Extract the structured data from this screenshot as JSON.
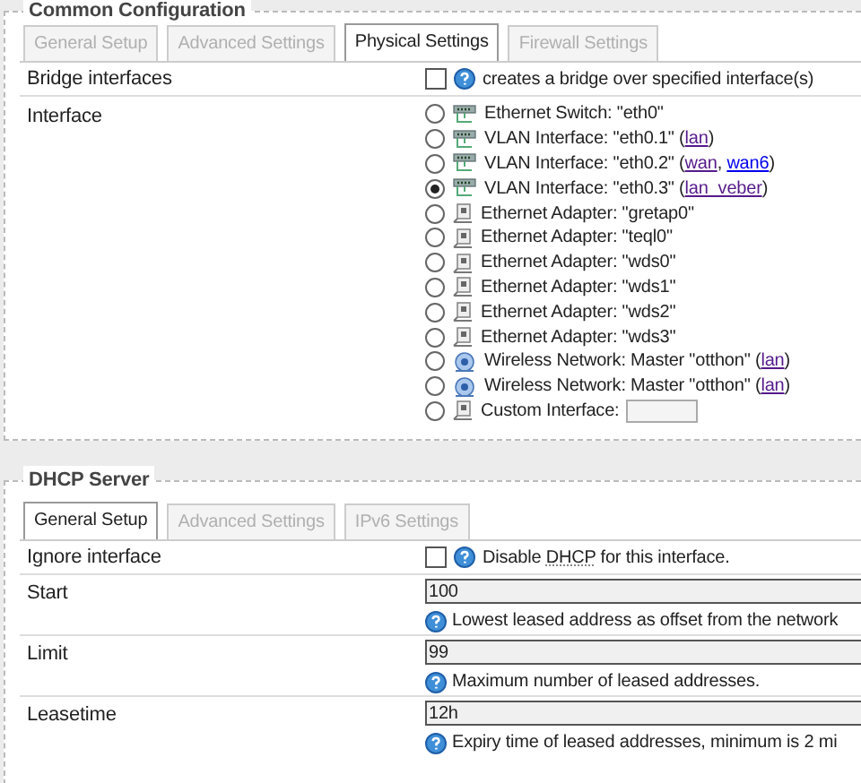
{
  "common": {
    "legend": "Common Configuration",
    "tabs": [
      {
        "label": "General Setup",
        "selected": false
      },
      {
        "label": "Advanced Settings",
        "selected": false
      },
      {
        "label": "Physical Settings",
        "selected": true
      },
      {
        "label": "Firewall Settings",
        "selected": false
      }
    ],
    "bridge": {
      "label": "Bridge interfaces",
      "checked": false,
      "help": "creates a bridge over specified interface(s)"
    },
    "interface": {
      "label": "Interface",
      "options": [
        {
          "kind": "switch",
          "selected": false,
          "parts": [
            {
              "kind": "text",
              "text": "Ethernet Switch: \"eth0\""
            }
          ]
        },
        {
          "kind": "switch",
          "selected": false,
          "parts": [
            {
              "kind": "text",
              "text": "VLAN Interface: \"eth0.1\" ("
            },
            {
              "kind": "link",
              "text": "lan",
              "visited": true
            },
            {
              "kind": "text",
              "text": ")"
            }
          ]
        },
        {
          "kind": "switch",
          "selected": false,
          "parts": [
            {
              "kind": "text",
              "text": "VLAN Interface: \"eth0.2\" ("
            },
            {
              "kind": "link",
              "text": "wan",
              "visited": true
            },
            {
              "kind": "text",
              "text": ", "
            },
            {
              "kind": "link",
              "text": "wan6",
              "visited": false
            },
            {
              "kind": "text",
              "text": ")"
            }
          ]
        },
        {
          "kind": "switch",
          "selected": true,
          "parts": [
            {
              "kind": "text",
              "text": "VLAN Interface: \"eth0.3\" ("
            },
            {
              "kind": "link",
              "text": "lan_veber",
              "visited": true
            },
            {
              "kind": "text",
              "text": ")"
            }
          ]
        },
        {
          "kind": "adapter",
          "selected": false,
          "parts": [
            {
              "kind": "text",
              "text": "Ethernet Adapter: \"gretap0\""
            }
          ]
        },
        {
          "kind": "adapter",
          "selected": false,
          "parts": [
            {
              "kind": "text",
              "text": "Ethernet Adapter: \"teql0\""
            }
          ]
        },
        {
          "kind": "adapter",
          "selected": false,
          "parts": [
            {
              "kind": "text",
              "text": "Ethernet Adapter: \"wds0\""
            }
          ]
        },
        {
          "kind": "adapter",
          "selected": false,
          "parts": [
            {
              "kind": "text",
              "text": "Ethernet Adapter: \"wds1\""
            }
          ]
        },
        {
          "kind": "adapter",
          "selected": false,
          "parts": [
            {
              "kind": "text",
              "text": "Ethernet Adapter: \"wds2\""
            }
          ]
        },
        {
          "kind": "adapter",
          "selected": false,
          "parts": [
            {
              "kind": "text",
              "text": "Ethernet Adapter: \"wds3\""
            }
          ]
        },
        {
          "kind": "wireless",
          "selected": false,
          "parts": [
            {
              "kind": "text",
              "text": "Wireless Network: Master \"otthon\" ("
            },
            {
              "kind": "link",
              "text": "lan",
              "visited": true
            },
            {
              "kind": "text",
              "text": ")"
            }
          ]
        },
        {
          "kind": "wireless",
          "selected": false,
          "parts": [
            {
              "kind": "text",
              "text": "Wireless Network: Master \"otthon\" ("
            },
            {
              "kind": "link",
              "text": "lan",
              "visited": true
            },
            {
              "kind": "text",
              "text": ")"
            }
          ]
        },
        {
          "kind": "custom",
          "selected": false,
          "parts": [
            {
              "kind": "text",
              "text": "Custom Interface:"
            }
          ]
        }
      ]
    }
  },
  "dhcp": {
    "legend": "DHCP Server",
    "tabs": [
      {
        "label": "General Setup",
        "selected": true
      },
      {
        "label": "Advanced Settings",
        "selected": false
      },
      {
        "label": "IPv6 Settings",
        "selected": false
      }
    ],
    "ignore": {
      "label": "Ignore interface",
      "checked": false,
      "parts": [
        {
          "kind": "text",
          "text": "Disable "
        },
        {
          "kind": "abbr",
          "text": "DHCP"
        },
        {
          "kind": "text",
          "text": " for this interface."
        }
      ]
    },
    "fields": [
      {
        "label": "Start",
        "value": "100",
        "help": "Lowest leased address as offset from the network"
      },
      {
        "label": "Limit",
        "value": "99",
        "help": "Maximum number of leased addresses."
      },
      {
        "label": "Leasetime",
        "value": "12h",
        "help": "Expiry time of leased addresses, minimum is 2 mi"
      }
    ]
  }
}
